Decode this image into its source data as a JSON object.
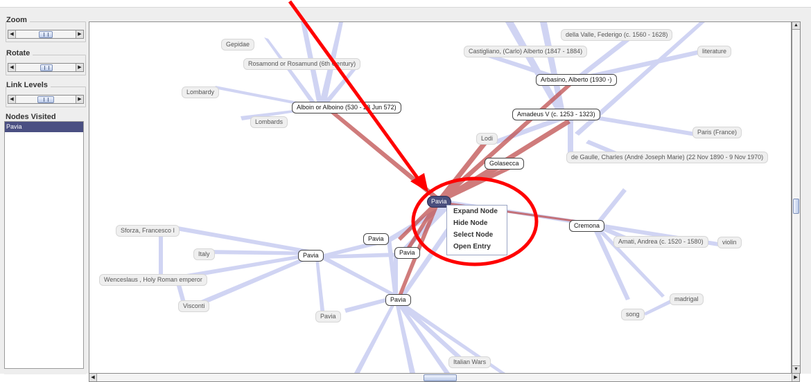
{
  "controls": {
    "zoom_label": "Zoom",
    "rotate_label": "Rotate",
    "link_levels_label": "Link Levels",
    "nodes_visited_label": "Nodes Visited",
    "zoom_level": 0.5,
    "rotate_level": 0.5,
    "link_levels_level": 0.5
  },
  "visited": [
    "Pavia"
  ],
  "graph": {
    "selected": "Pavia",
    "nodes": {
      "gepidae": "Gepidae",
      "rosamond": "Rosamond or Rosamund (6th Century)",
      "lombardy": "Lombardy",
      "alboin": "Alboin or Alboino (530 - 28 Jun 572)",
      "lombards": "Lombards",
      "dellavalle": "della Valle, Federigo (c. 1560 - 1628)",
      "castigliano": "Castigliano, (Carlo) Alberto (1847 - 1884)",
      "literature": "literature",
      "arbasino": "Arbasino, Alberto (1930 -)",
      "amadeus": "Amadeus V (c. 1253 - 1323)",
      "lodi": "Lodi",
      "paris": "Paris (France)",
      "degaulle": "de Gaulle, Charles (André Joseph Marie) (22 Nov 1890 - 9 Nov 1970)",
      "golasecca": "Golasecca",
      "pavia_center": "Pavia",
      "cremona": "Cremona",
      "amati": "Amati, Andrea (c. 1520 - 1580)",
      "violin": "violin",
      "sforza": "Sforza, Francesco I",
      "italy": "Italy",
      "pavia_a": "Pavia",
      "pavia_b": "Pavia",
      "pavia_c": "Pavia",
      "wenceslaus": "Wenceslaus , Holy Roman emperor",
      "visconti": "Visconti",
      "pavia_d": "Pavia",
      "pavia_e": "Pavia",
      "madrigal": "madrigal",
      "song": "song",
      "italianwars": "Italian Wars"
    }
  },
  "context_menu": {
    "items": [
      "Expand Node",
      "Hide Node",
      "Select Node",
      "Open Entry"
    ]
  },
  "colors": {
    "link": "#c8cdf2",
    "highlight_link": "#c05050",
    "selected_node": "#4a4f7d",
    "annotation": "#ff0000"
  }
}
